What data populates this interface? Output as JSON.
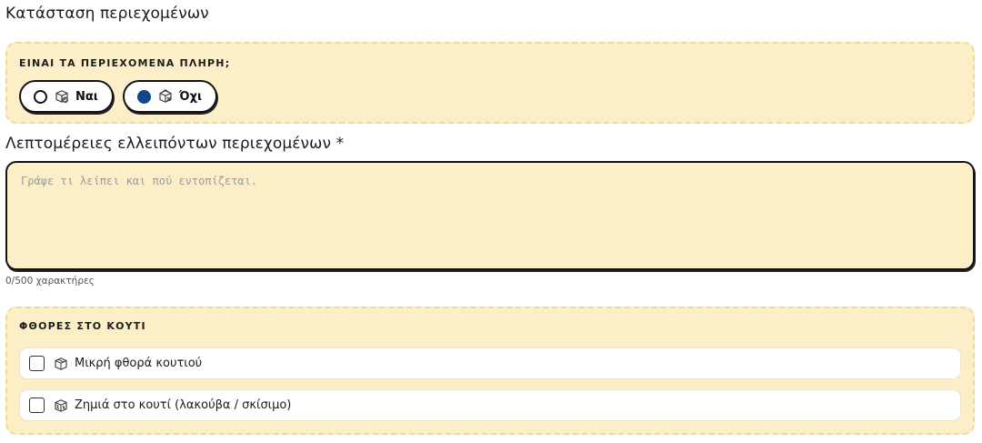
{
  "status_section": {
    "title": "Κατάσταση περιεχομένων",
    "question": "ΕΙΝΑΙ ΤΑ ΠΕΡΙΕΧΟΜΕΝΑ ΠΛΗΡΗ;",
    "options": [
      {
        "label": "Ναι",
        "icon": "package-check-icon",
        "selected": false
      },
      {
        "label": "Όχι",
        "icon": "package-missing-icon",
        "selected": true
      }
    ],
    "accent_color": "#11458c"
  },
  "details_section": {
    "title": "Λεπτομέρειες ελλειπόντων περιεχομένων *",
    "placeholder": "Γράψε τι λείπει και πού εντοπίζεται.",
    "value": "",
    "counter": "0/500 χαρακτήρες"
  },
  "damage_section": {
    "title": "ΦΘΟΡΕΣ ΣΤΟ ΚΟΥΤΙ",
    "options": [
      {
        "label": "Μικρή φθορά κουτιού",
        "icon": "box-icon",
        "checked": false
      },
      {
        "label": "Ζημιά στο κουτί (λακούβα / σκίσιμο)",
        "icon": "damaged-box-icon",
        "checked": false
      }
    ]
  },
  "colors": {
    "panel_bg": "#fcefc7",
    "panel_border": "#efd99a"
  }
}
